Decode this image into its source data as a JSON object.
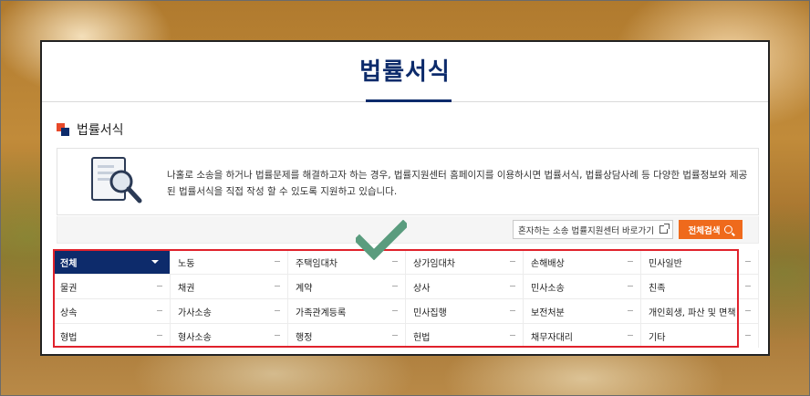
{
  "page": {
    "title": "법률서식"
  },
  "section": {
    "title": "법률서식"
  },
  "info": {
    "text": "나홀로 소송을 하거나 법률문제를 해결하고자 하는 경우, 법률지원센터 홈페이지를 이용하시면 법률서식, 법률상담사례 등 다양한 법률정보와 제공된 법률서식을 직접 작성 할 수 있도록 지원하고 있습니다.",
    "icon": "document-search-icon"
  },
  "actions": {
    "shortcut_label": "혼자하는 소송 법률지원센터 바로가기",
    "search_label": "전체검색"
  },
  "categories": [
    [
      "전체",
      "노동",
      "주택임대차",
      "상가임대차",
      "손해배상",
      "민사일반"
    ],
    [
      "물권",
      "채권",
      "계약",
      "상사",
      "민사소송",
      "친족"
    ],
    [
      "상속",
      "가사소송",
      "가족관계등록",
      "민사집행",
      "보전처분",
      "개인회생, 파산 및 면책"
    ],
    [
      "형법",
      "형사소송",
      "행정",
      "헌법",
      "채무자대리",
      "기타"
    ]
  ],
  "colors": {
    "brand": "#0d2b6b",
    "accent": "#ef6a1c",
    "highlight_frame": "#e0212b",
    "checkmark": "#5a9c7e"
  }
}
